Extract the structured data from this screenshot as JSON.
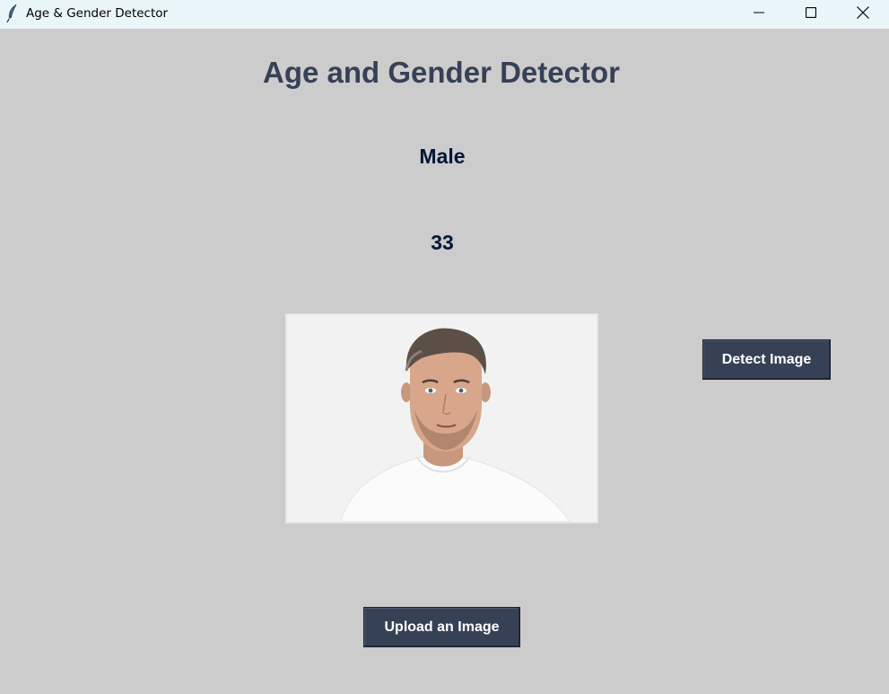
{
  "window": {
    "title": "Age & Gender Detector",
    "icon": "feather-icon",
    "controls": [
      "minimize-icon",
      "maximize-icon",
      "close-icon"
    ]
  },
  "app": {
    "heading": "Age and Gender Detector",
    "gender_result": "Male",
    "age_result": "33",
    "image": {
      "icon": "uploaded-portrait-image"
    },
    "buttons": {
      "detect_label": "Detect Image",
      "upload_label": "Upload an Image"
    }
  },
  "colors": {
    "background": "#cccccc",
    "heading": "#364156",
    "result_text": "#011638",
    "button_bg": "#364156",
    "button_text": "#ffffff",
    "titlebar": "#eaf5f9"
  }
}
